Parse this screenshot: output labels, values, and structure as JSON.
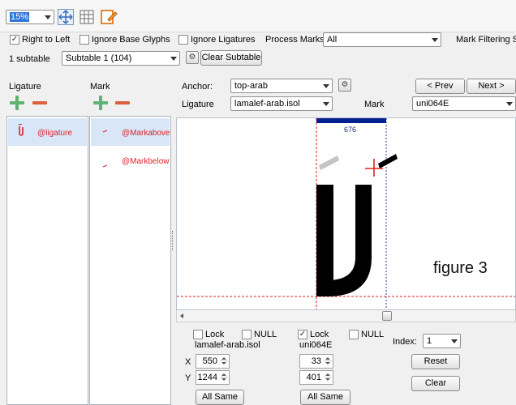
{
  "toolbar": {
    "zoom_value": "15%",
    "icons": [
      "fit-view-icon",
      "grid-view-icon",
      "edit-pencil-icon"
    ]
  },
  "options": {
    "right_to_left": {
      "label": "Right to Left",
      "checked": true
    },
    "ignore_base_glyphs": {
      "label": "Ignore Base Glyphs",
      "checked": false
    },
    "ignore_ligatures": {
      "label": "Ignore Ligatures",
      "checked": false
    },
    "process_marks_label": "Process Marks:",
    "process_marks_value": "All",
    "mark_filtering_label": "Mark Filtering Se"
  },
  "subtable": {
    "count_label": "1 subtable",
    "selected": "Subtable 1 (104)",
    "clear_label": "Clear Subtable"
  },
  "ligature_panel": {
    "header": "Ligature",
    "items": [
      {
        "label": "@ligature"
      }
    ]
  },
  "mark_panel": {
    "header": "Mark",
    "items": [
      {
        "label": "@Markabove"
      },
      {
        "label": "@Markbelow"
      }
    ]
  },
  "anchor": {
    "anchor_label": "Anchor:",
    "anchor_value": "top-arab",
    "ligature_label": "Ligature",
    "ligature_value": "lamalef-arab.isol",
    "mark_label": "Mark",
    "mark_value": "uni064E",
    "prev_label": "< Prev",
    "next_label": "Next >"
  },
  "canvas": {
    "advance_width": "676",
    "annotation": "figure 3"
  },
  "positions": {
    "ligature": {
      "lock_label": "Lock",
      "lock_checked": false,
      "null_label": "NULL",
      "null_checked": false,
      "glyph_name": "lamalef-arab.isol",
      "x_label": "X",
      "x_value": "550",
      "y_label": "Y",
      "y_value": "1244",
      "same_label": "All Same"
    },
    "mark": {
      "lock_label": "Lock",
      "lock_checked": true,
      "null_label": "NULL",
      "null_checked": false,
      "glyph_name": "uni064E",
      "x_value": "33",
      "y_value": "401",
      "same_label": "All Same"
    },
    "index_label": "Index:",
    "index_value": "1",
    "reset_label": "Reset",
    "clear_label": "Clear"
  }
}
